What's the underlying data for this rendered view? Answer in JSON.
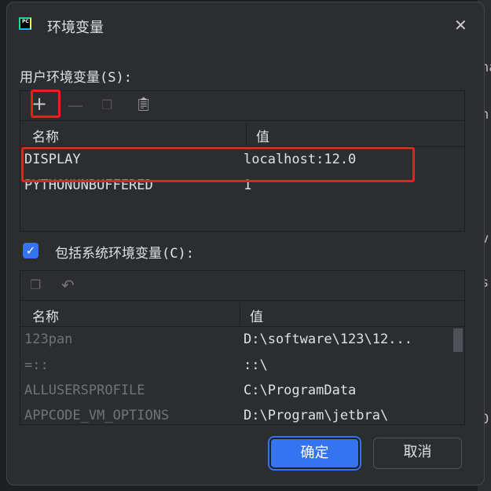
{
  "window": {
    "title": "环境变量",
    "close_icon": "close-icon"
  },
  "user_vars": {
    "label": "用户环境变量(S):",
    "header_name": "名称",
    "header_value": "值",
    "rows": [
      {
        "name": "DISPLAY",
        "value": "localhost:12.0"
      },
      {
        "name": "PYTHONUNBUFFERED",
        "value": "1"
      }
    ]
  },
  "system_vars": {
    "checkbox_label": "包括系统环境变量(C):",
    "checked": true,
    "header_name": "名称",
    "header_value": "值",
    "rows": [
      {
        "name": "123pan",
        "value": "D:\\software\\123\\12..."
      },
      {
        "name": "=::",
        "value": "::\\"
      },
      {
        "name": "ALLUSERSPROFILE",
        "value": "C:\\ProgramData"
      },
      {
        "name": "APPCODE_VM_OPTIONS",
        "value": "D:\\Program\\jetbra\\"
      }
    ]
  },
  "buttons": {
    "ok": "确定",
    "cancel": "取消"
  },
  "background": {
    "fragments": [
      "na",
      "n",
      "v",
      "s",
      "O"
    ]
  },
  "colors": {
    "accent": "#3574f0",
    "highlight": "#f01c1c"
  }
}
